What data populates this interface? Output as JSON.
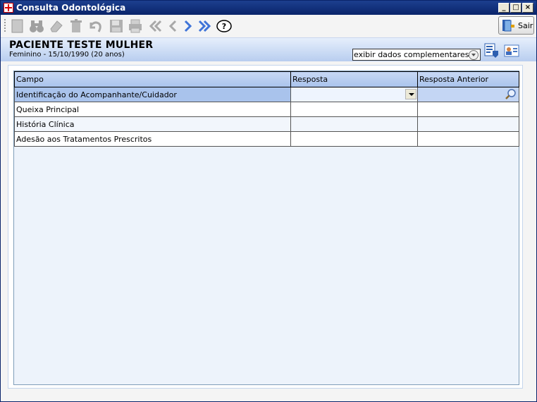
{
  "window": {
    "title": "Consulta Odontológica",
    "buttons": {
      "minimize": "_",
      "maximize": "□",
      "close": "×"
    }
  },
  "toolbar": {
    "tools": [
      "new-icon",
      "search-binoculars-icon",
      "eraser-icon",
      "trash-icon",
      "undo-icon",
      "save-icon",
      "print-icon",
      "first-icon",
      "previous-icon",
      "next-icon",
      "last-icon",
      "help-icon"
    ],
    "exit_label": "Sair"
  },
  "patient": {
    "name": "PACIENTE TESTE MULHER",
    "info": "Feminino - 15/10/1990 (20 anos)",
    "complement_select": "exibir dados complementares..."
  },
  "grid": {
    "columns": [
      "Campo",
      "Resposta",
      "Resposta Anterior"
    ],
    "rows": [
      {
        "campo": "Identificação do Acompanhante/Cuidador",
        "resposta": "",
        "anterior": ""
      },
      {
        "campo": "Queixa Principal",
        "resposta": "",
        "anterior": ""
      },
      {
        "campo": "História Clínica",
        "resposta": "",
        "anterior": ""
      },
      {
        "campo": "Adesão aos Tratamentos Prescritos",
        "resposta": "",
        "anterior": ""
      }
    ]
  },
  "colors": {
    "titlebar": "#0a246a",
    "header": "#a9c3ec",
    "panel": "#b8cdef"
  }
}
